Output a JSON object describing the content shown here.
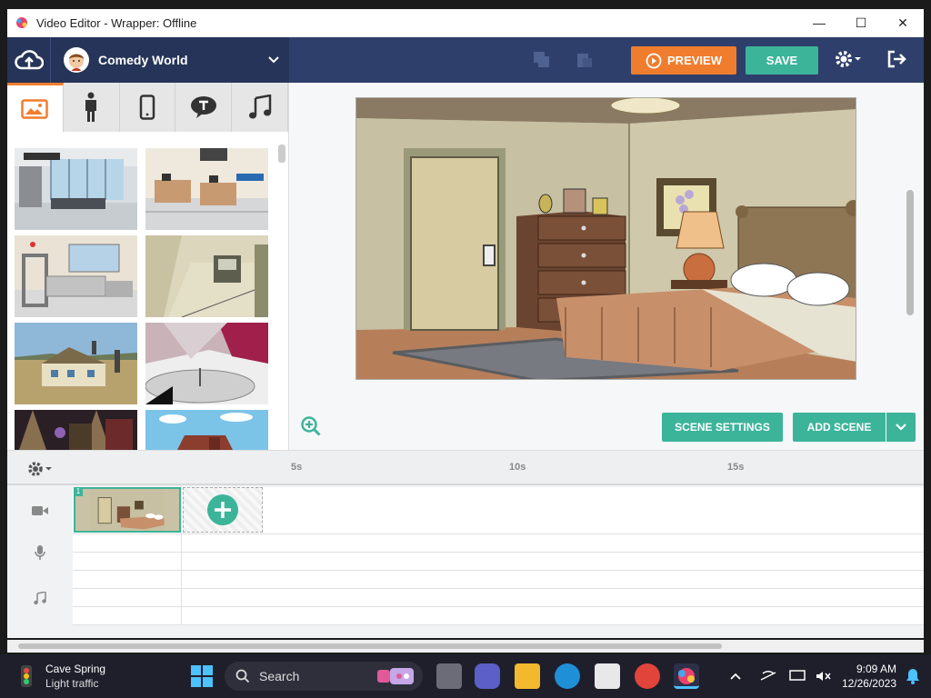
{
  "window": {
    "title": "Video Editor - Wrapper: Offline"
  },
  "topbar": {
    "theme_name": "Comedy World",
    "preview_label": "PREVIEW",
    "save_label": "SAVE"
  },
  "stage": {
    "scene_settings_label": "SCENE SETTINGS",
    "add_scene_label": "ADD SCENE"
  },
  "timeline": {
    "ruler": [
      "5s",
      "10s",
      "15s"
    ],
    "scene_number": "1"
  },
  "taskbar": {
    "weather_location": "Cave Spring",
    "weather_condition": "Light traffic",
    "search_label": "Search",
    "time": "9:09 AM",
    "date": "12/26/2023"
  },
  "colors": {
    "nav": "#2f3f6b",
    "preview": "#f07d2e",
    "save": "#3cb49a",
    "accent": "#3cb49a"
  }
}
